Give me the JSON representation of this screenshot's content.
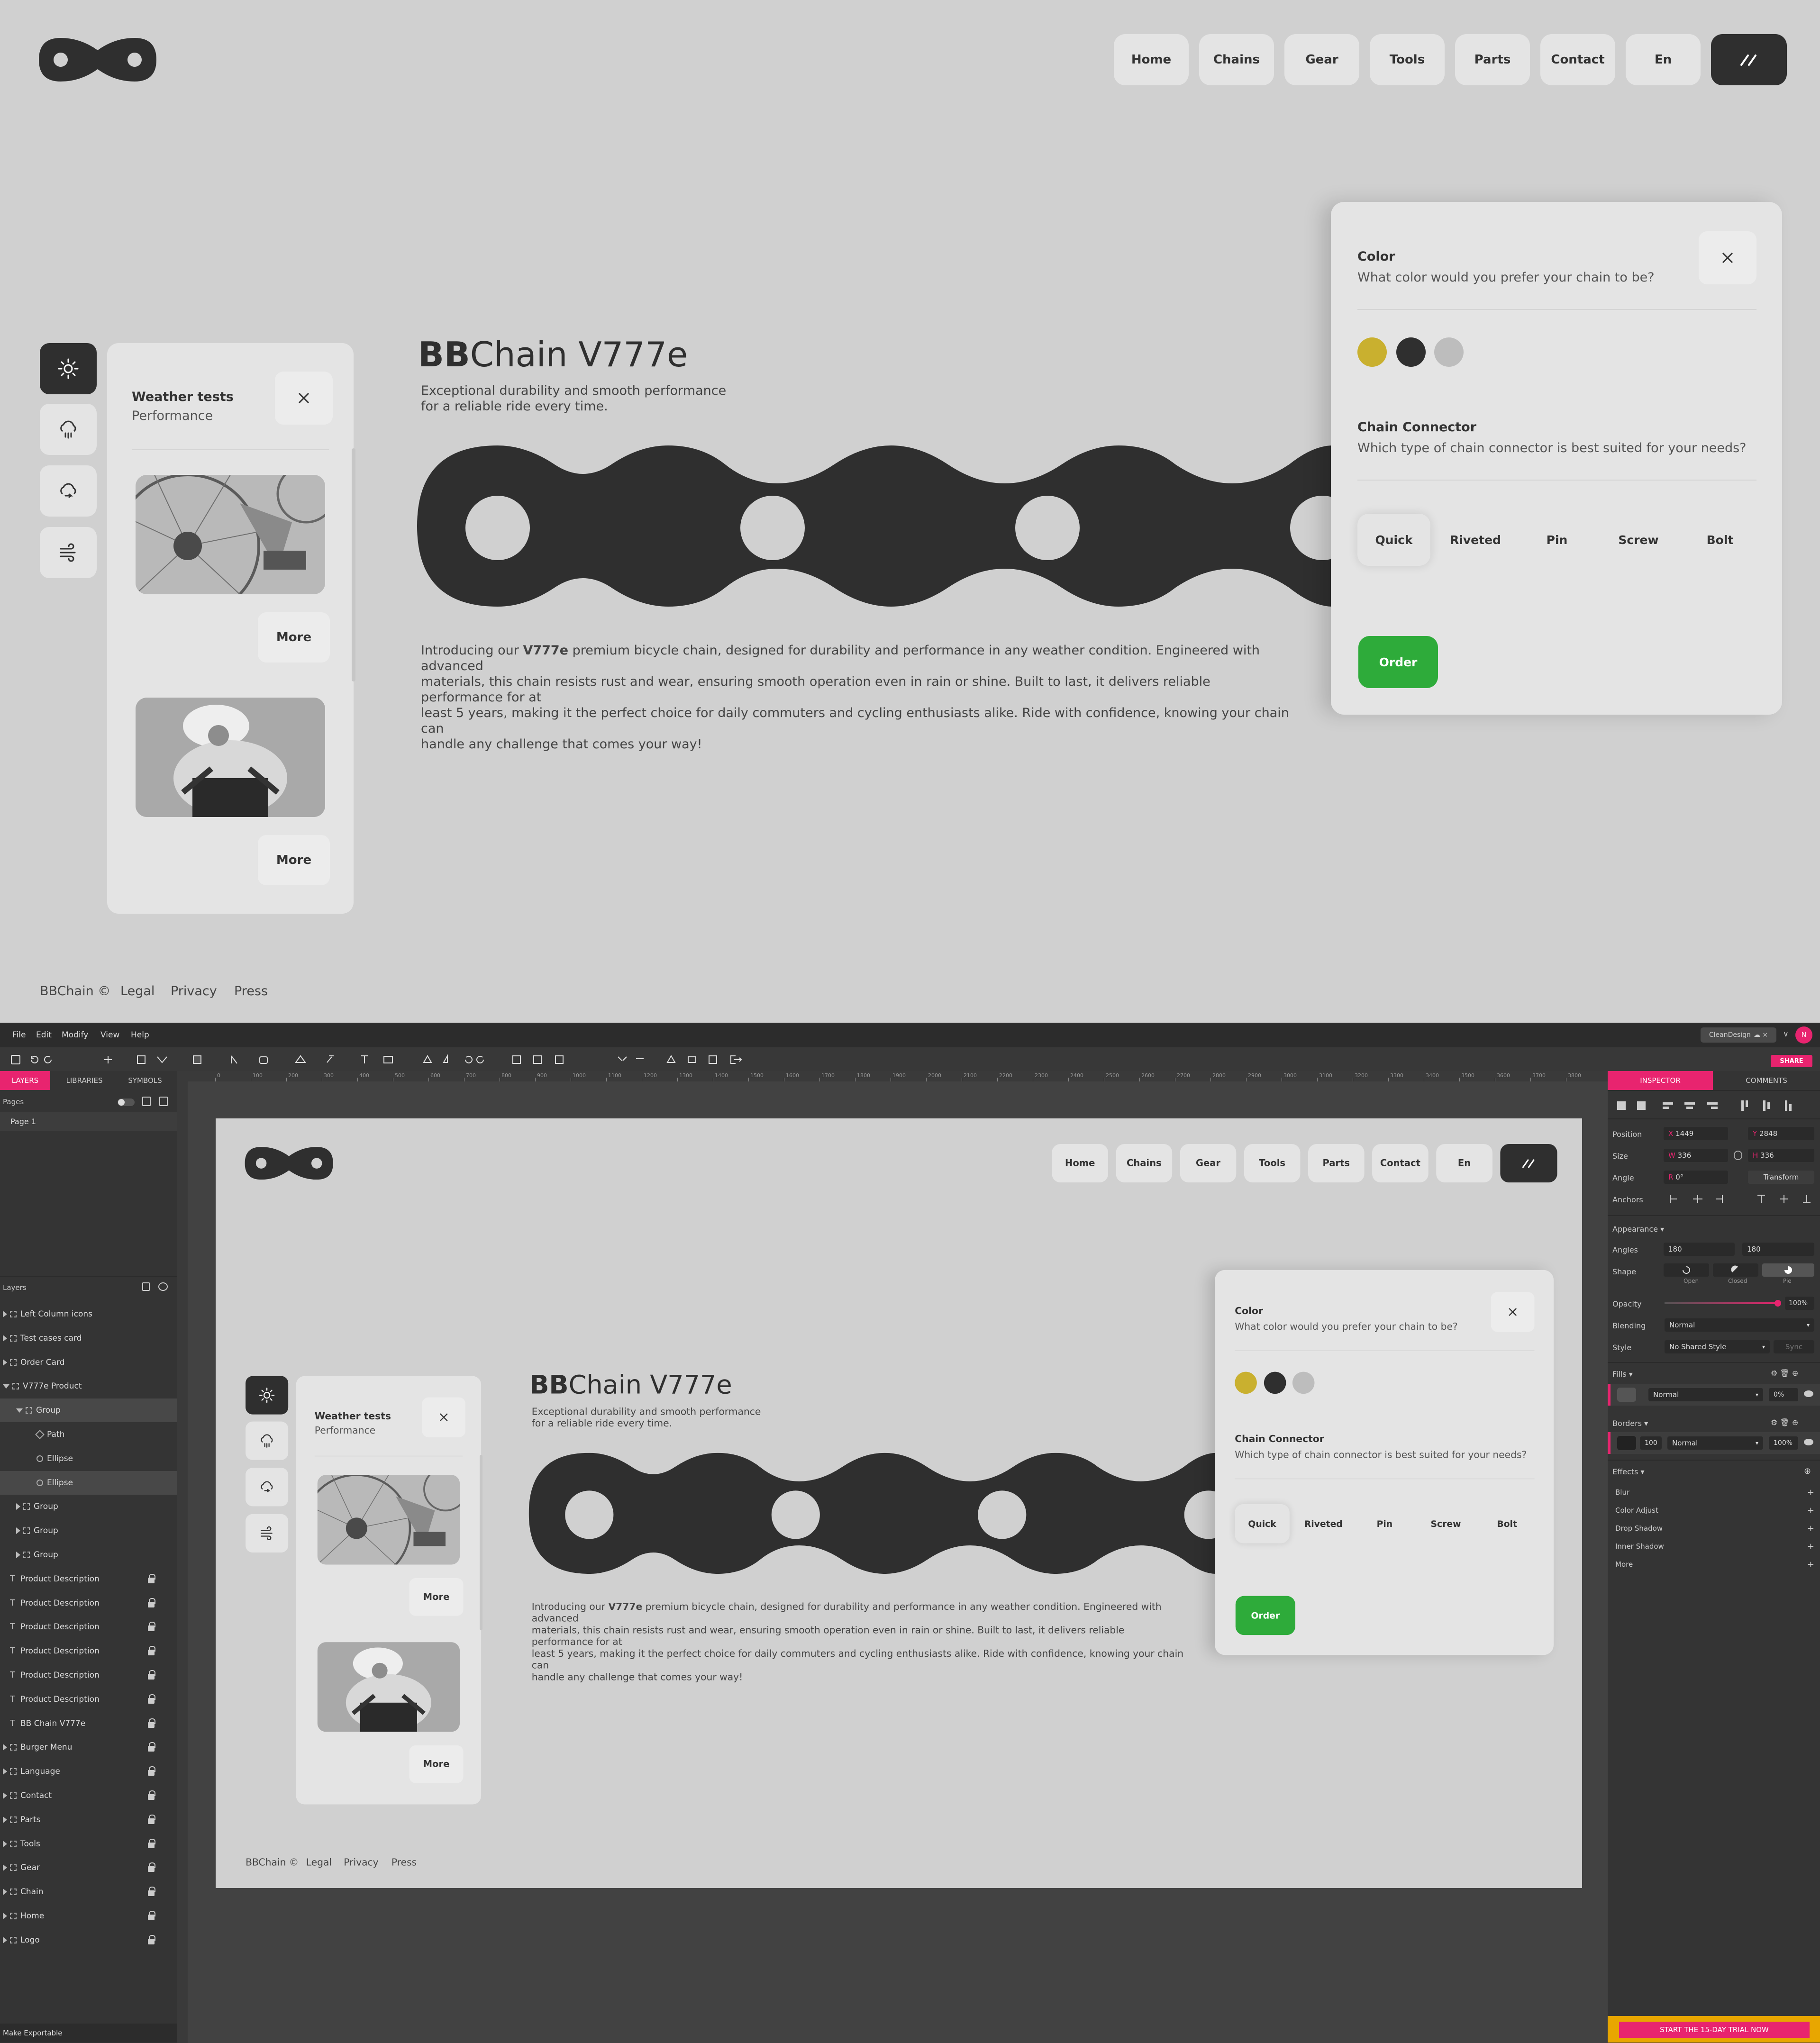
{
  "site": {
    "nav": [
      "Home",
      "Chains",
      "Gear",
      "Tools",
      "Parts",
      "Contact",
      "En"
    ],
    "title_bold": "BB",
    "title_rest": "Chain V777e",
    "subtitle_line1": "Exceptional durability and smooth performance",
    "subtitle_line2": "for a reliable ride every time.",
    "desc_pre": "Introducing our ",
    "desc_bold": "V777e",
    "desc_line1": " premium bicycle chain, designed for durability and performance in any weather condition. Engineered with advanced",
    "desc_line2": "materials, this chain resists rust and wear, ensuring smooth operation even in rain or shine. Built to last, it delivers reliable performance for at",
    "desc_line3": "least 5 years, making it the perfect choice for daily commuters and cycling enthusiasts alike. Ride with confidence, knowing your chain can",
    "desc_line4": "handle any challenge that comes your way!",
    "weather_title": "Weather tests",
    "weather_sub": "Performance",
    "more": "More",
    "color_title": "Color",
    "color_q": "What color would you prefer your chain to be?",
    "colors": [
      "#c9b02f",
      "#2f2f2f",
      "#bdbdbd"
    ],
    "connector_title": "Chain Connector",
    "connector_q": "Which type of chain connector is best suited for your needs?",
    "connectors": [
      "Quick",
      "Riveted",
      "Pin",
      "Screw",
      "Bolt"
    ],
    "order": "Order",
    "order_color": "#2eab3a",
    "footer": [
      "BBChain ©",
      "Legal",
      "Privacy",
      "Press"
    ]
  },
  "editor": {
    "menu": [
      "File",
      "Edit",
      "Modify",
      "View",
      "Help"
    ],
    "cloud_badge": "CleanDesign",
    "avatar": "N",
    "share": "SHARE",
    "left_tabs": [
      "LAYERS",
      "LIBRARIES",
      "SYMBOLS"
    ],
    "pages_label": "Pages",
    "page1": "Page 1",
    "layers_label": "Layers",
    "layers": [
      {
        "name": "Left Column icons",
        "indent": 0,
        "kind": "group",
        "exp": "closed",
        "lock": false
      },
      {
        "name": "Test cases card",
        "indent": 0,
        "kind": "group",
        "exp": "closed",
        "lock": false
      },
      {
        "name": "Order Card",
        "indent": 0,
        "kind": "group",
        "exp": "closed",
        "lock": false
      },
      {
        "name": "V777e Product",
        "indent": 0,
        "kind": "group",
        "exp": "open",
        "lock": false
      },
      {
        "name": "Group",
        "indent": 1,
        "kind": "group",
        "exp": "open",
        "lock": false,
        "sel": true
      },
      {
        "name": "Path",
        "indent": 2,
        "kind": "path",
        "exp": "none",
        "lock": false
      },
      {
        "name": "Ellipse",
        "indent": 2,
        "kind": "ellipse",
        "exp": "none",
        "lock": false
      },
      {
        "name": "Ellipse",
        "indent": 2,
        "kind": "ellipse",
        "exp": "none",
        "lock": false,
        "sel": true
      },
      {
        "name": "Group",
        "indent": 1,
        "kind": "group",
        "exp": "closed",
        "lock": false
      },
      {
        "name": "Group",
        "indent": 1,
        "kind": "group",
        "exp": "closed",
        "lock": false
      },
      {
        "name": "Group",
        "indent": 1,
        "kind": "group",
        "exp": "closed",
        "lock": false
      },
      {
        "name": "Product Description",
        "indent": 0,
        "kind": "text",
        "exp": "none",
        "lock": true
      },
      {
        "name": "Product Description",
        "indent": 0,
        "kind": "text",
        "exp": "none",
        "lock": true
      },
      {
        "name": "Product Description",
        "indent": 0,
        "kind": "text",
        "exp": "none",
        "lock": true
      },
      {
        "name": "Product Description",
        "indent": 0,
        "kind": "text",
        "exp": "none",
        "lock": true
      },
      {
        "name": "Product Description",
        "indent": 0,
        "kind": "text",
        "exp": "none",
        "lock": true
      },
      {
        "name": "Product Description",
        "indent": 0,
        "kind": "text",
        "exp": "none",
        "lock": true
      },
      {
        "name": "BB Chain V777e",
        "indent": 0,
        "kind": "text",
        "exp": "none",
        "lock": true
      },
      {
        "name": "Burger Menu",
        "indent": 0,
        "kind": "group",
        "exp": "closed",
        "lock": true
      },
      {
        "name": "Language",
        "indent": 0,
        "kind": "group",
        "exp": "closed",
        "lock": true
      },
      {
        "name": "Contact",
        "indent": 0,
        "kind": "group",
        "exp": "closed",
        "lock": true
      },
      {
        "name": "Parts",
        "indent": 0,
        "kind": "group",
        "exp": "closed",
        "lock": true
      },
      {
        "name": "Tools",
        "indent": 0,
        "kind": "group",
        "exp": "closed",
        "lock": true
      },
      {
        "name": "Gear",
        "indent": 0,
        "kind": "group",
        "exp": "closed",
        "lock": true
      },
      {
        "name": "Chain",
        "indent": 0,
        "kind": "group",
        "exp": "closed",
        "lock": true
      },
      {
        "name": "Home",
        "indent": 0,
        "kind": "group",
        "exp": "closed",
        "lock": true
      },
      {
        "name": "Logo",
        "indent": 0,
        "kind": "group",
        "exp": "closed",
        "lock": true
      }
    ],
    "make_exportable": "Make Exportable",
    "ruler_labels": [
      "0",
      "100",
      "200",
      "300",
      "400",
      "500",
      "600",
      "700",
      "800",
      "900",
      "1000",
      "1100",
      "1200",
      "1300",
      "1400",
      "1500",
      "1600",
      "1700",
      "1800",
      "1900",
      "2000",
      "2100",
      "2200",
      "2300",
      "2400",
      "2500",
      "2600",
      "2700",
      "2800",
      "2900",
      "3000",
      "3100",
      "3200",
      "3300",
      "3400",
      "3500",
      "3600",
      "3700",
      "3800"
    ],
    "inspector": {
      "tabs": [
        "INSPECTOR",
        "COMMENTS"
      ],
      "position_label": "Position",
      "x_label": "X",
      "x": "1449",
      "y_label": "Y",
      "y": "2848",
      "size_label": "Size",
      "w_label": "W",
      "w": "336",
      "h_label": "H",
      "h": "336",
      "angle_label": "Angle",
      "angle": "0°",
      "transform": "Transform",
      "anchors_label": "Anchors",
      "appearance": "Appearance",
      "angles_label": "Angles",
      "angle_a": "180",
      "angle_b": "180",
      "shape_label": "Shape",
      "shape_opts": [
        "Open",
        "Closed",
        "Pie"
      ],
      "opacity_label": "Opacity",
      "opacity": "100%",
      "blending_label": "Blending",
      "blending": "Normal",
      "style_label": "Style",
      "style": "No Shared Style",
      "sync": "Sync",
      "fills": "Fills",
      "fill_blend": "Normal",
      "fill_opacity": "0%",
      "borders": "Borders",
      "border_width": "100",
      "border_blend": "Normal",
      "border_opacity": "100%",
      "effects": "Effects",
      "effect_list": [
        "Blur",
        "Color Adjust",
        "Drop Shadow",
        "Inner Shadow",
        "More"
      ],
      "trial": "START THE 15-DAY TRIAL NOW"
    },
    "accent": "#e8246f"
  }
}
